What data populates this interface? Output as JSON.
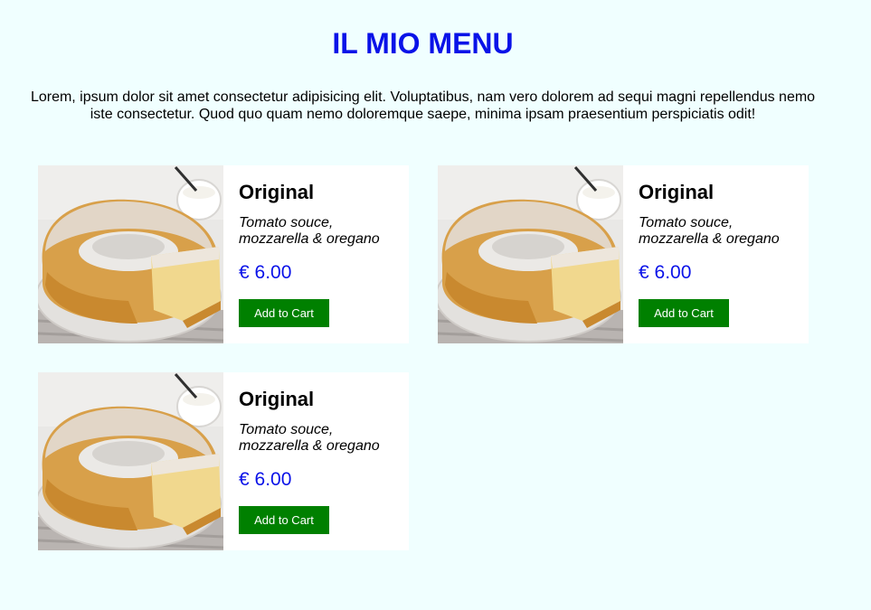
{
  "header": {
    "title": "IL MIO MENU",
    "intro": "Lorem, ipsum dolor sit amet consectetur adipisicing elit. Voluptatibus, nam vero dolorem ad sequi magni repellendus nemo iste consectetur. Quod quo quam nemo doloremque saepe, minima ipsam praesentium perspiciatis odit!"
  },
  "colors": {
    "background": "#f0ffff",
    "title": "#0a12e8",
    "price": "#0a12e8",
    "button": "#008000"
  },
  "items": [
    {
      "name": "Original",
      "description": "Tomato souce, mozzarella & oregano",
      "price": "€ 6.00",
      "button_label": "Add to Cart",
      "image": "bundt-cake-photo"
    },
    {
      "name": "Original",
      "description": "Tomato souce, mozzarella & oregano",
      "price": "€ 6.00",
      "button_label": "Add to Cart",
      "image": "bundt-cake-photo"
    },
    {
      "name": "Original",
      "description": "Tomato souce, mozzarella & oregano",
      "price": "€ 6.00",
      "button_label": "Add to Cart",
      "image": "bundt-cake-photo"
    }
  ]
}
